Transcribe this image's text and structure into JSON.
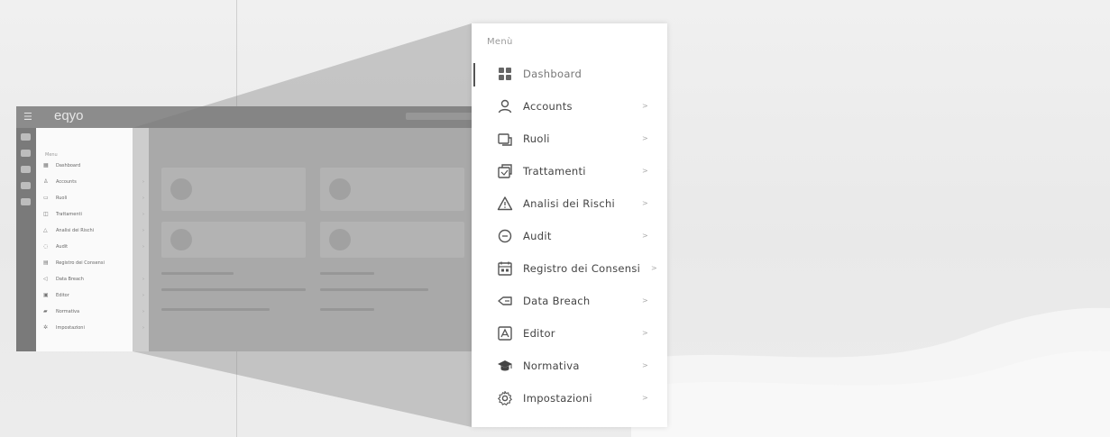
{
  "mini_screenshot": {
    "logo": "eqyo",
    "menu_title": "Menu",
    "items": [
      "Dashboard",
      "Accounts",
      "Ruoli",
      "Trattamenti",
      "Analisi dei Rischi",
      "Audit",
      "Registro dei Consensi",
      "Data Breach",
      "Editor",
      "Normativa",
      "Impostazioni"
    ]
  },
  "menu": {
    "title": "Menù",
    "items": [
      {
        "label": "Dashboard",
        "icon": "dashboard-icon",
        "chevron": ""
      },
      {
        "label": "Accounts",
        "icon": "user-icon",
        "chevron": ">"
      },
      {
        "label": "Ruoli",
        "icon": "roles-icon",
        "chevron": ">"
      },
      {
        "label": "Trattamenti",
        "icon": "treatments-icon",
        "chevron": ">"
      },
      {
        "label": "Analisi dei Rischi",
        "icon": "warning-icon",
        "chevron": ">"
      },
      {
        "label": "Audit",
        "icon": "audit-icon",
        "chevron": ">"
      },
      {
        "label": "Registro dei Consensi",
        "icon": "register-icon",
        "chevron": ">"
      },
      {
        "label": "Data Breach",
        "icon": "breach-icon",
        "chevron": ">"
      },
      {
        "label": "Editor",
        "icon": "editor-icon",
        "chevron": ">"
      },
      {
        "label": "Normativa",
        "icon": "graduation-cap-icon",
        "chevron": ">"
      },
      {
        "label": "Impostazioni",
        "icon": "gear-icon",
        "chevron": ">"
      }
    ]
  },
  "colors": {
    "background": "#ebebeb",
    "panel": "#ffffff",
    "text": "#444444",
    "muted": "#9a9a9a"
  }
}
